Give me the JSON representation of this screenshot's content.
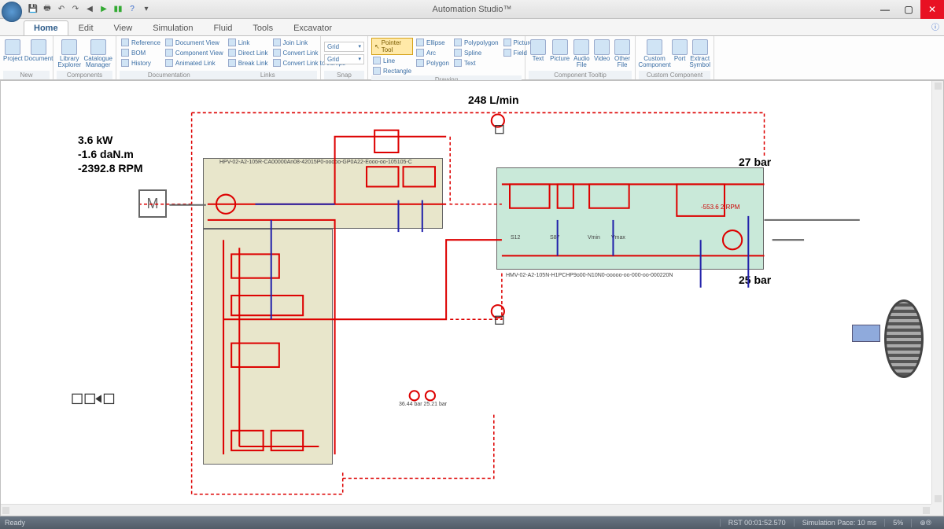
{
  "app": {
    "title": "Automation Studio™"
  },
  "tabs": [
    "Home",
    "Edit",
    "View",
    "Simulation",
    "Fluid",
    "Tools",
    "Excavator"
  ],
  "ribbon": {
    "new": {
      "label": "New",
      "project": "Project",
      "document": "Document"
    },
    "components": {
      "label": "Components",
      "library": "Library Explorer",
      "catalogue": "Catalogue Manager"
    },
    "documentation": {
      "label": "Documentation",
      "reference": "Reference",
      "docview": "Document View",
      "bom": "BOM",
      "compview": "Component View",
      "history": "History",
      "animated": "Animated Link",
      "link": "Link",
      "joinlink": "Join Link",
      "directlink": "Direct Link",
      "convertlink": "Convert Link",
      "breaklink": "Break Link",
      "convertjumps": "Convert Link to Jumps"
    },
    "links": {
      "label": "Links"
    },
    "snap": {
      "label": "Snap",
      "grid": "Grid"
    },
    "drawing": {
      "label": "Drawing",
      "pointer": "Pointer Tool",
      "ellipse": "Ellipse",
      "poly": "Polypolygon",
      "picture": "Picture",
      "line": "Line",
      "arc": "Arc",
      "spline": "Spline",
      "field": "Field",
      "rect": "Rectangle",
      "polygon": "Polygon",
      "text": "Text"
    },
    "tooltip": {
      "label": "Component Tooltip",
      "textb": "Text",
      "pic": "Picture",
      "audio": "Audio File",
      "video": "Video",
      "other": "Other File"
    },
    "custom": {
      "label": "Custom Component",
      "comp": "Custom Component",
      "port": "Port",
      "extract": "Extract Symbol"
    }
  },
  "measurements": {
    "power": "3.6 kW",
    "torque": "-1.6 daN.m",
    "rpm": "-2392.8 RPM",
    "flow": "248 L/min",
    "p1": "27 bar",
    "p2": "25 bar",
    "bottom_vals": "36.44 bar  25.21 bar"
  },
  "labels": {
    "part1": "HPV-02-A2-105R-CA00000An08-42015P0-ooooo-GP0A22-Eooo-oo-105105-C",
    "part2": "HMV-02-A2-105N-H1PCHP9o00-N10N0-ooooo-oo-000-oo-000220N",
    "motor": "M",
    "vmin": "Vmin",
    "vmax": "Vmax",
    "s12": "S12",
    "s87": "S87",
    "rpm2": "-553.6 2 RPM"
  },
  "status": {
    "ready": "Ready",
    "rst": "RST 00:01:52.570",
    "pace": "Simulation Pace: 10 ms",
    "pct": "5%"
  }
}
